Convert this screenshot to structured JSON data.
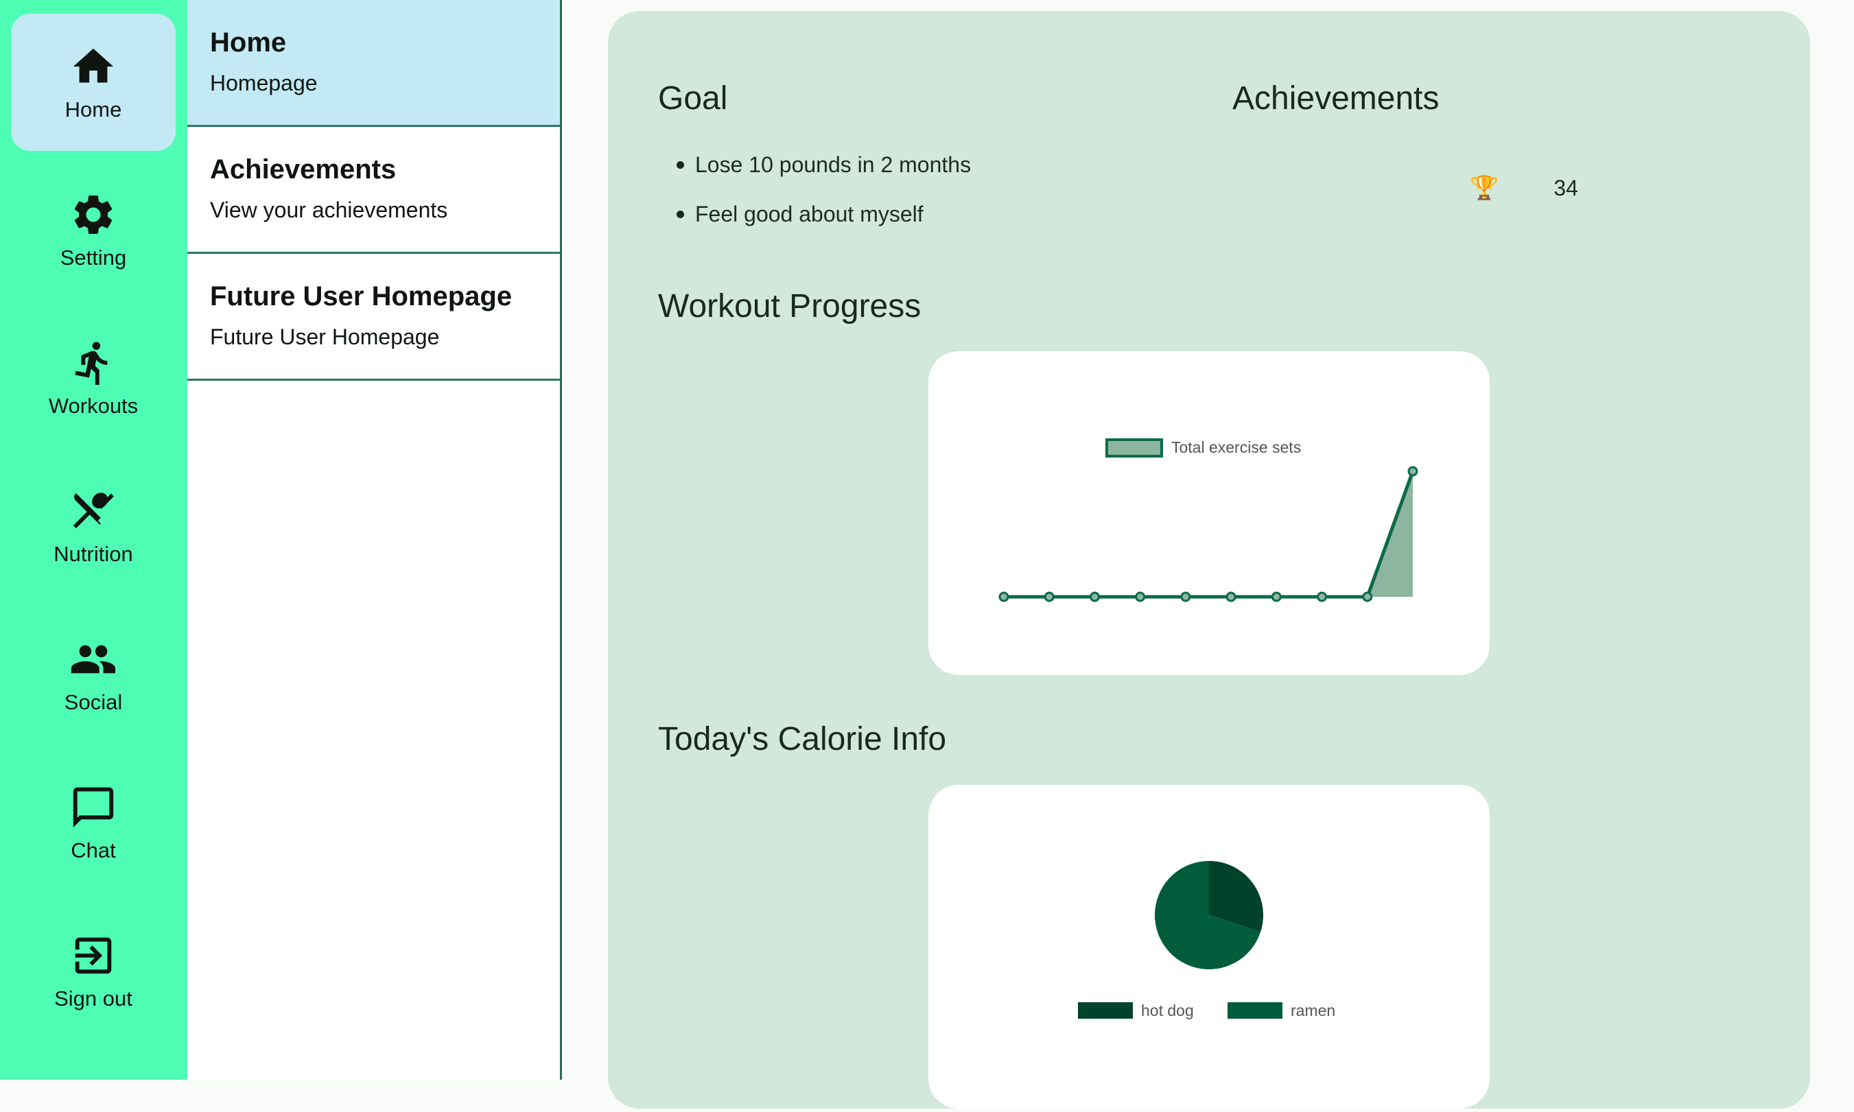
{
  "rail": [
    {
      "label": "Home",
      "icon": "home-icon",
      "active": true
    },
    {
      "label": "Setting",
      "icon": "gear-icon"
    },
    {
      "label": "Workouts",
      "icon": "running-icon"
    },
    {
      "label": "Nutrition",
      "icon": "utensils-icon"
    },
    {
      "label": "Social",
      "icon": "people-icon"
    },
    {
      "label": "Chat",
      "icon": "chat-icon"
    },
    {
      "label": "Sign out",
      "icon": "exit-icon"
    }
  ],
  "subnav": [
    {
      "title": "Home",
      "subtitle": "Homepage",
      "active": true
    },
    {
      "title": "Achievements",
      "subtitle": "View your achievements"
    },
    {
      "title": "Future User Homepage",
      "subtitle": "Future User Homepage"
    }
  ],
  "main": {
    "goal_title": "Goal",
    "goals": [
      "Lose 10 pounds in 2 months",
      "Feel good about myself"
    ],
    "achievements_title": "Achievements",
    "trophy_icon": "🏆",
    "achievements_count": "34",
    "workout_title": "Workout Progress",
    "calorie_title": "Today's Calorie Info"
  },
  "colors": {
    "rail_bg": "#4efdb4",
    "active_bg": "#c2e9f4",
    "card_bg": "#d1e8da",
    "line": "#0b6b48",
    "fill": "#8db59f",
    "pie_dark": "#00432a",
    "pie_main": "#005c3a"
  },
  "chart_data": [
    {
      "type": "area",
      "legend": [
        "Total exercise sets"
      ],
      "series": [
        {
          "name": "Total exercise sets",
          "values": [
            0,
            0,
            0,
            0,
            0,
            0,
            0,
            0,
            0,
            1
          ]
        }
      ],
      "ylim": [
        0,
        1
      ]
    },
    {
      "type": "pie",
      "categories": [
        "hot dog",
        "ramen"
      ],
      "values": [
        0.3,
        0.7
      ]
    }
  ]
}
